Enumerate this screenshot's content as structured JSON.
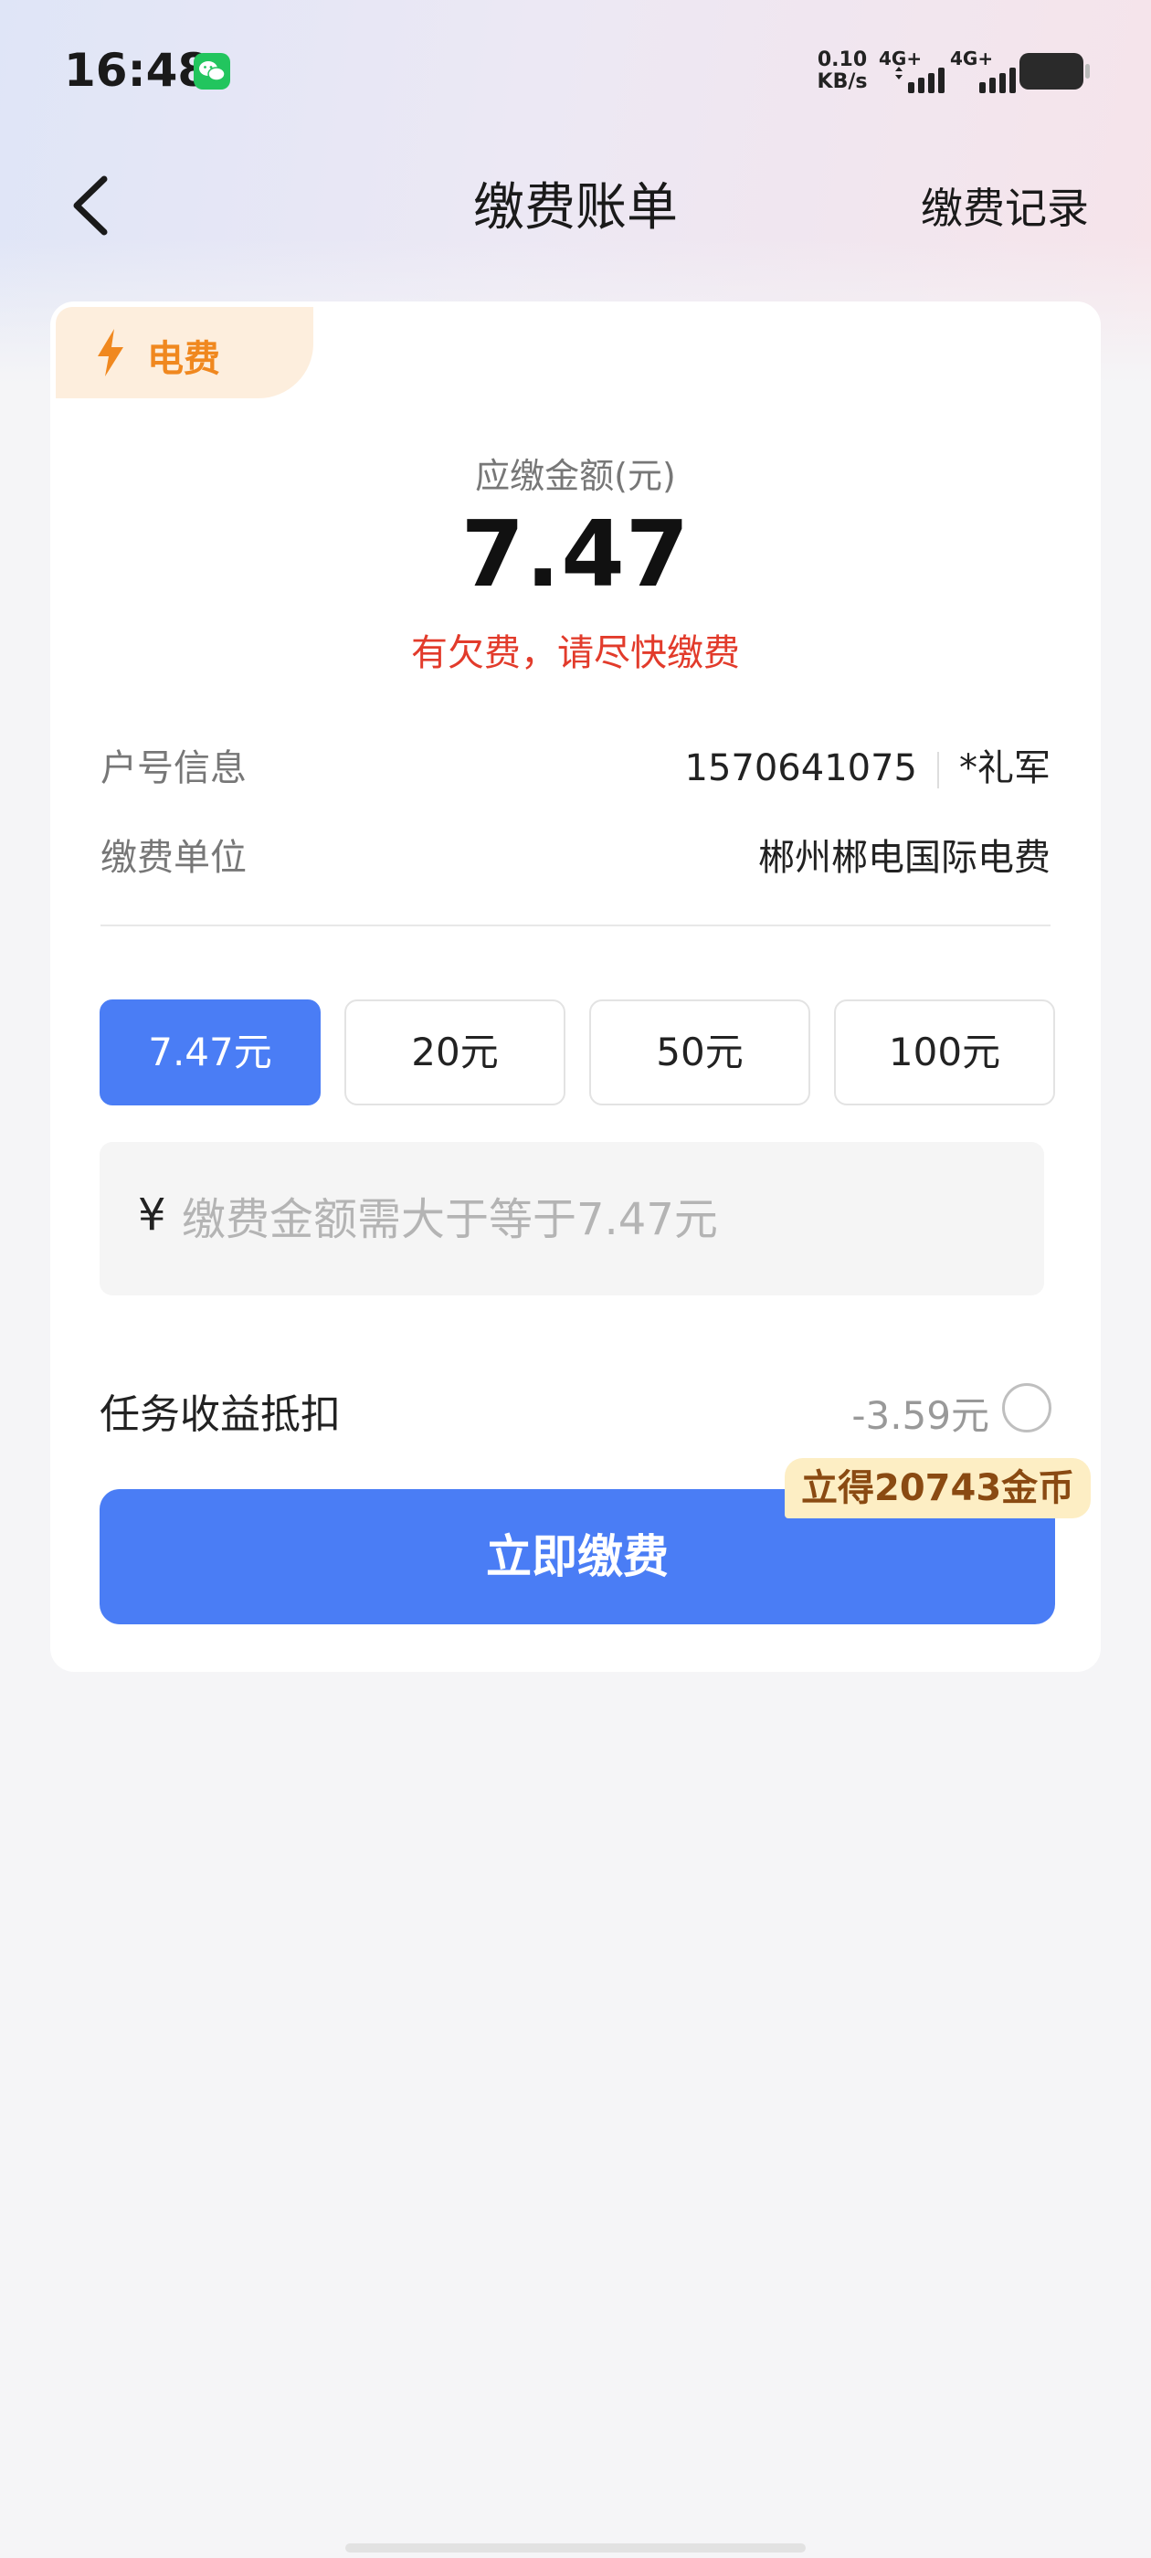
{
  "status_bar": {
    "time": "16:48",
    "net_speed_value": "0.10",
    "net_speed_unit": "KB/s",
    "signal_1": "4G+",
    "signal_2": "4G+"
  },
  "header": {
    "title": "缴费账单",
    "records_link": "缴费记录"
  },
  "bill": {
    "category_badge": "电费",
    "due_label": "应缴金额(元)",
    "due_amount": "7.47",
    "warning": "有欠费，请尽快缴费",
    "account_label": "户号信息",
    "account_number": "1570641075",
    "account_name": "*礼军",
    "unit_label": "缴费单位",
    "unit_value": "郴州郴电国际电费"
  },
  "amount_options": [
    {
      "label": "7.47元",
      "selected": true
    },
    {
      "label": "20元",
      "selected": false
    },
    {
      "label": "50元",
      "selected": false
    },
    {
      "label": "100元",
      "selected": false
    }
  ],
  "amount_input": {
    "currency": "¥",
    "value": "",
    "placeholder": "缴费金额需大于等于7.47元"
  },
  "deduction": {
    "label": "任务收益抵扣",
    "value": "-3.59元",
    "checked": false
  },
  "pay": {
    "button_label": "立即缴费",
    "reward_tag": "立得20743金币"
  },
  "colors": {
    "primary": "#4a7df5",
    "warning": "#e23b2b",
    "badge_text": "#f0881f",
    "reward_bg": "#fdeec4"
  }
}
